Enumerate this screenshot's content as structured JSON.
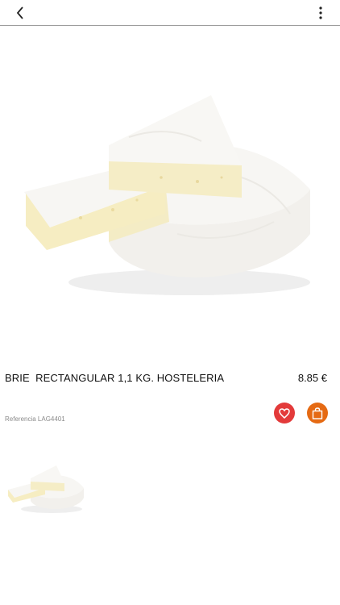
{
  "header": {
    "back_icon": "chevron-left-icon",
    "menu_icon": "more-vertical-icon"
  },
  "product": {
    "title": "BRIE  RECTANGULAR 1,1 KG. HOSTELERIA",
    "price": "8.85 €",
    "reference": "Referencia LAG4401"
  },
  "actions": {
    "favorite_icon": "heart-icon",
    "cart_icon": "shopping-bag-icon",
    "favorite_color": "#e33a3a",
    "cart_color": "#e56a13"
  },
  "gallery": {
    "thumbnails": [
      "brie-cheese-image"
    ]
  }
}
